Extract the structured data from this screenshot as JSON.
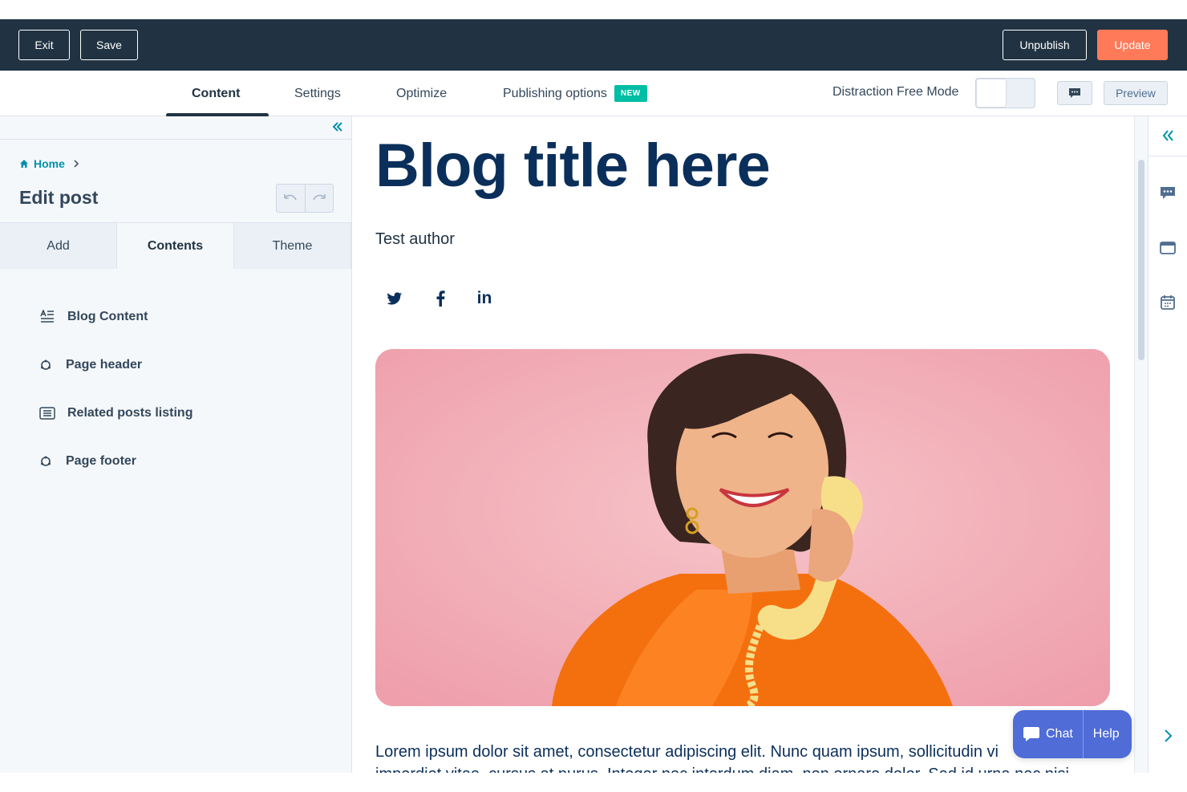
{
  "topbar": {
    "exit_label": "Exit",
    "save_label": "Save",
    "unpublish_label": "Unpublish",
    "update_label": "Update"
  },
  "tabs": {
    "content": "Content",
    "settings": "Settings",
    "optimize": "Optimize",
    "publishing": "Publishing options",
    "new_badge": "NEW",
    "distraction_free": "Distraction Free Mode",
    "preview": "Preview"
  },
  "sidebar": {
    "breadcrumb": "Home",
    "title": "Edit post",
    "tabs": [
      "Add",
      "Contents",
      "Theme"
    ],
    "items": [
      {
        "label": "Blog Content",
        "icon": "text-align-icon"
      },
      {
        "label": "Page header",
        "icon": "module-icon"
      },
      {
        "label": "Related posts listing",
        "icon": "list-icon"
      },
      {
        "label": "Page footer",
        "icon": "module-icon"
      }
    ]
  },
  "post": {
    "title": "Blog title here",
    "author": "Test author",
    "social": [
      "twitter-icon",
      "facebook-icon",
      "linkedin-icon"
    ],
    "body": "Lorem ipsum dolor sit amet, consectetur adipiscing elit. Nunc quam ipsum, sollicitudin vi",
    "body_line2": "imperdiet vitae, cursus at purus. Integer nec interdum diam, non ornare dolor. Sed id urna nec nisi"
  },
  "chat_widget": {
    "chat_label": "Chat",
    "help_label": "Help"
  },
  "colors": {
    "topbar": "#213343",
    "update": "#ff7a59",
    "accent": "#0091ae",
    "title": "#0b2f5b",
    "new_badge": "#00bda5",
    "chat": "#4f6cd7"
  }
}
